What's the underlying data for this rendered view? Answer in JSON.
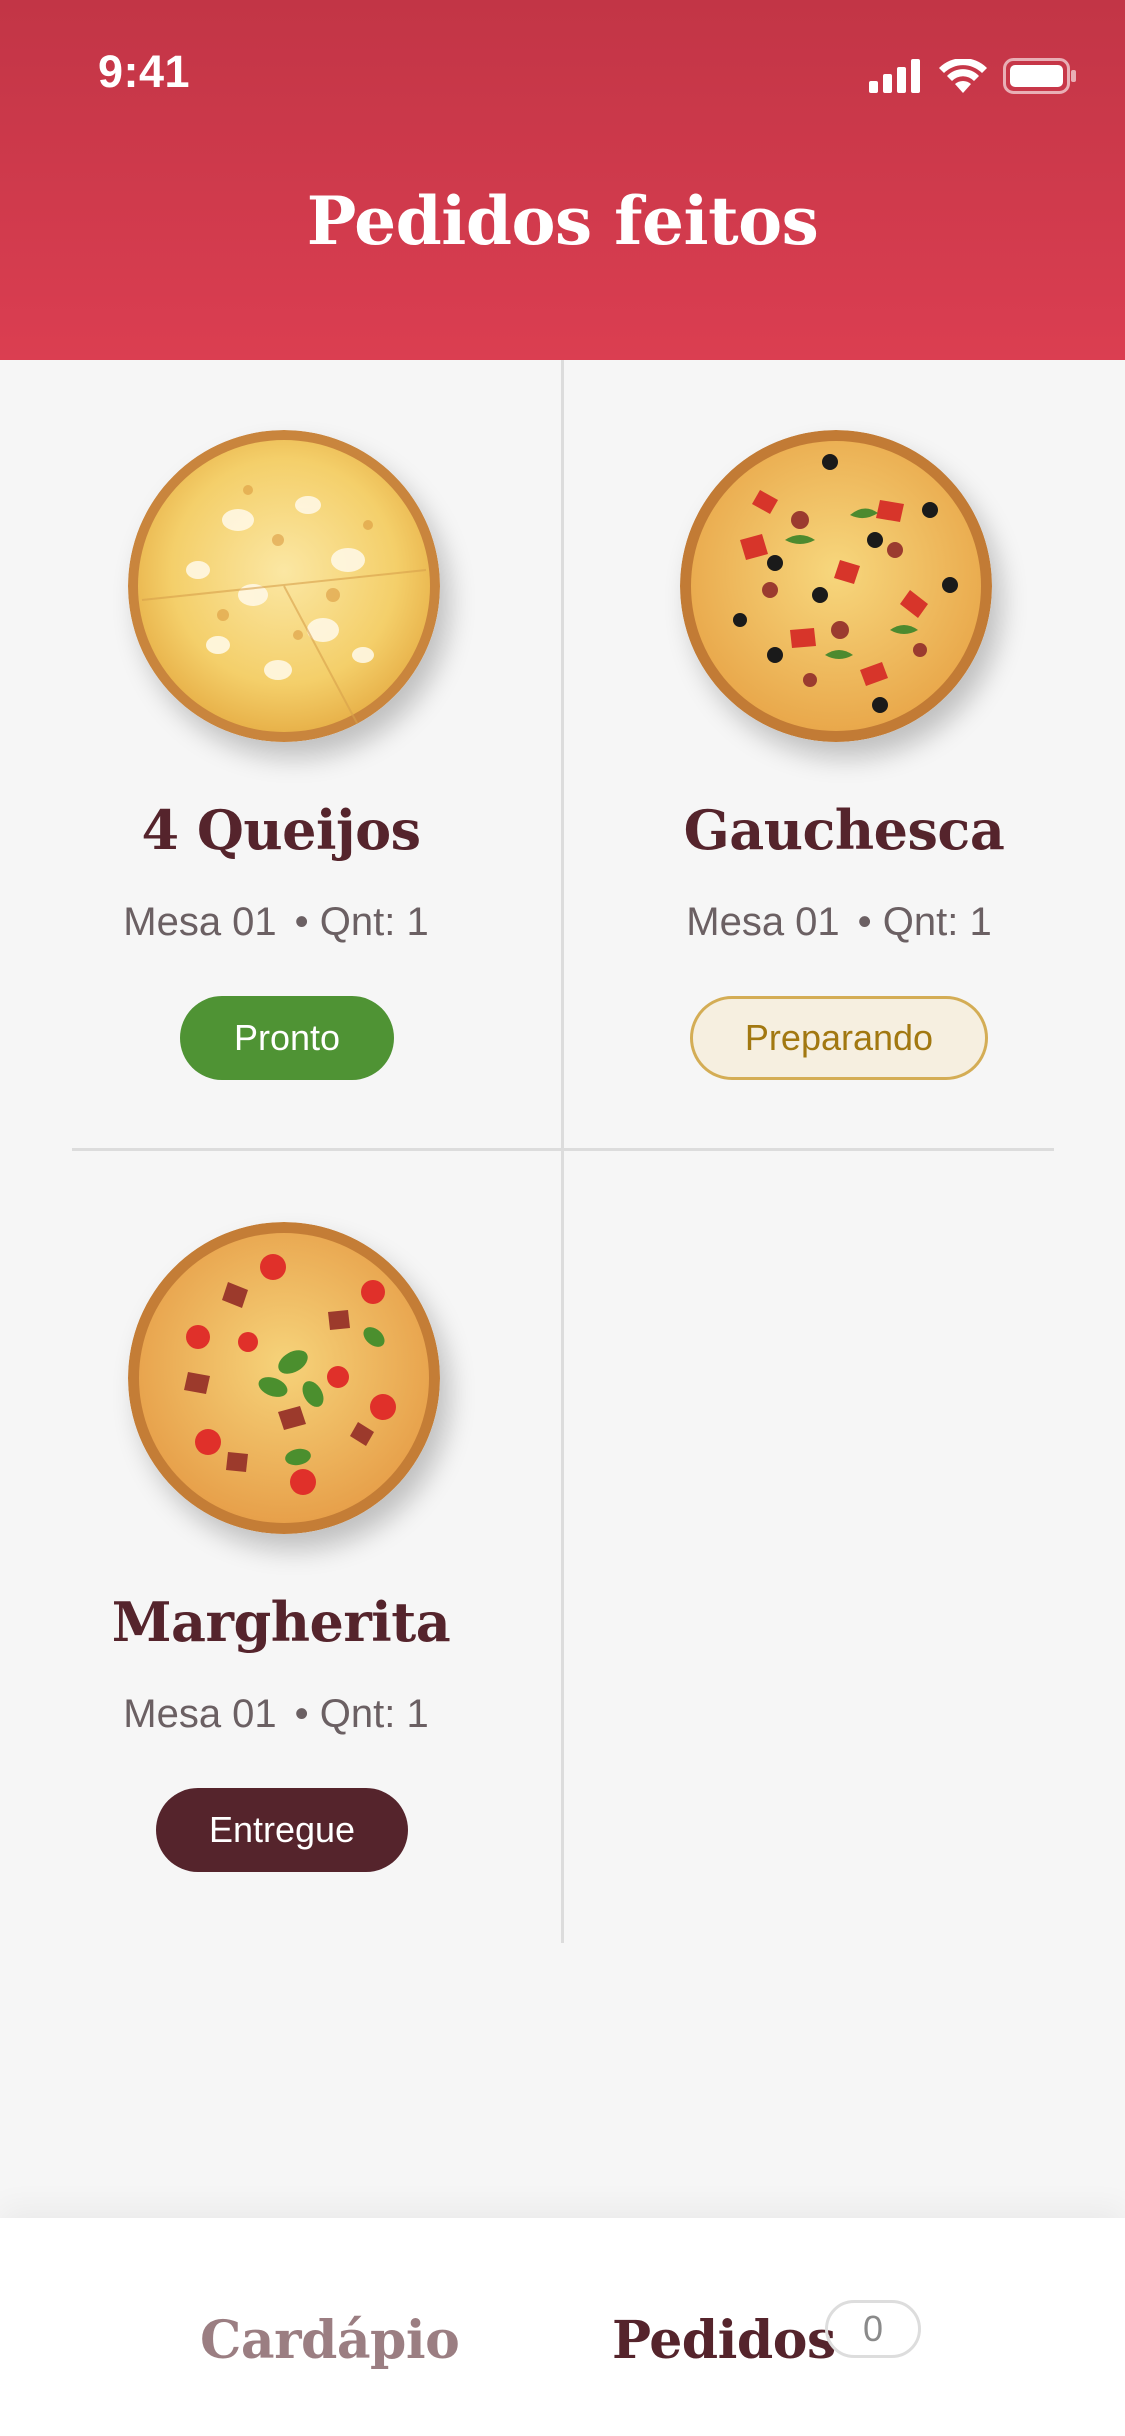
{
  "status_bar": {
    "time": "9:41"
  },
  "header": {
    "title": "Pedidos feitos"
  },
  "orders": [
    {
      "name": "4 Queijos",
      "table": "Mesa 01",
      "qty": "• Qnt: 1",
      "status": "Pronto"
    },
    {
      "name": "Gauchesca",
      "table": "Mesa 01",
      "qty": "• Qnt: 1",
      "status": "Preparando"
    },
    {
      "name": "Margherita",
      "table": "Mesa 01",
      "qty": "• Qnt: 1",
      "status": "Entregue"
    }
  ],
  "nav": {
    "menu_label": "Cardápio",
    "orders_label": "Pedidos",
    "orders_count": "0"
  },
  "colors": {
    "header_top": "#c23546",
    "header_bottom": "#db3e51",
    "title_text": "#55242c",
    "ready": "#4f9334",
    "preparing_bg": "#f6efe0",
    "preparing_text": "#a27811",
    "delivered": "#55242c"
  }
}
